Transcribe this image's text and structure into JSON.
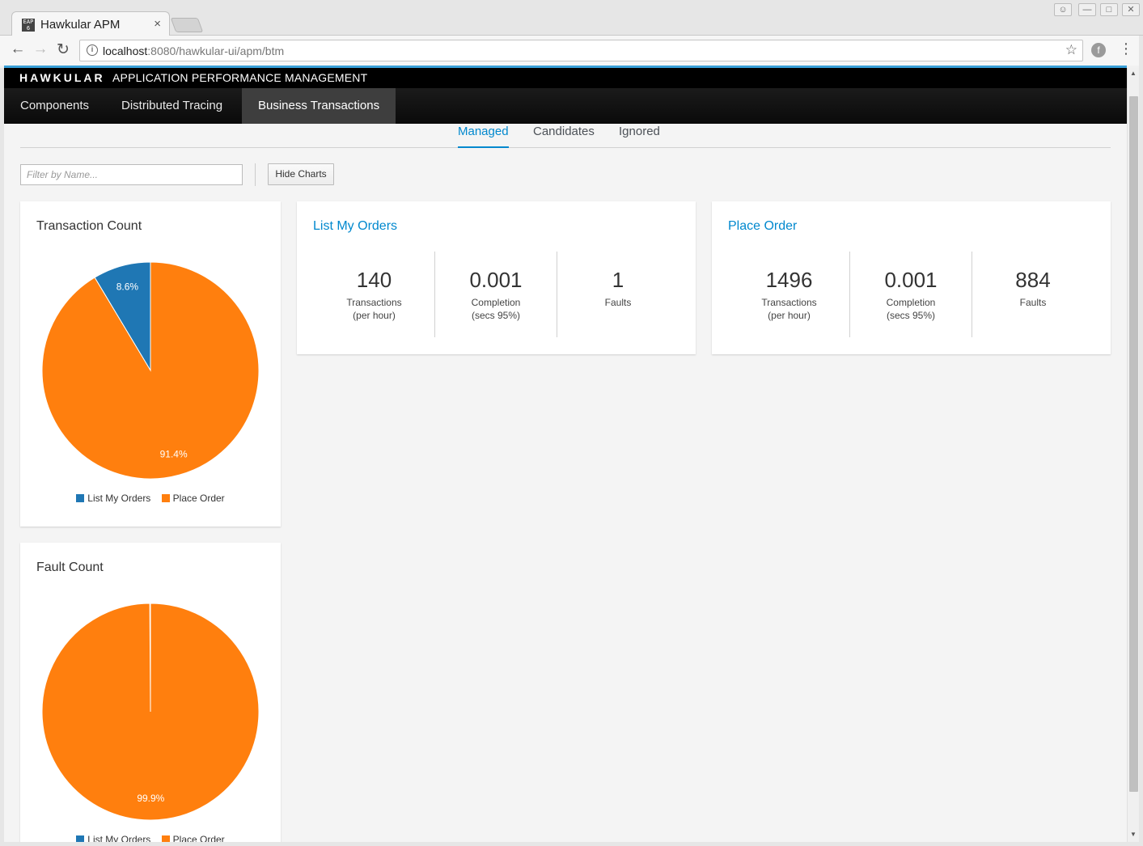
{
  "browser": {
    "tab_title": "Hawkular APM",
    "tab_favicon": "EAP 6",
    "tab_close": "×",
    "url_host": "localhost",
    "url_rest": ":8080/hawkular-ui/apm/btm",
    "icons": [
      "back-icon",
      "forward-icon",
      "reload-icon",
      "info-icon",
      "star-icon",
      "extension-icon",
      "menu-icon"
    ]
  },
  "header": {
    "brand": "HAWKULAR",
    "subtitle": "APPLICATION PERFORMANCE MANAGEMENT"
  },
  "nav": {
    "items": [
      {
        "label": "Components"
      },
      {
        "label": "Distributed Tracing"
      },
      {
        "label": "Business Transactions"
      }
    ],
    "active": "Business Transactions"
  },
  "subtabs": {
    "items": [
      {
        "label": "Managed"
      },
      {
        "label": "Candidates"
      },
      {
        "label": "Ignored"
      }
    ],
    "active": "Managed"
  },
  "filter": {
    "placeholder": "Filter by Name..."
  },
  "hide_charts_label": "Hide Charts",
  "colors": {
    "series_a": "#1f77b4",
    "series_b": "#ff7f0e",
    "link": "#0088ce"
  },
  "chart_data": [
    {
      "type": "pie",
      "title": "Transaction Count",
      "categories": [
        "List My Orders",
        "Place Order"
      ],
      "values": [
        8.6,
        91.4
      ],
      "labels": [
        "8.6%",
        "91.4%"
      ],
      "legend": "bottom"
    },
    {
      "type": "pie",
      "title": "Fault Count",
      "categories": [
        "List My Orders",
        "Place Order"
      ],
      "values": [
        0.1,
        99.9
      ],
      "labels": [
        "",
        "99.9%"
      ],
      "legend": "bottom"
    }
  ],
  "transactions": [
    {
      "name": "List My Orders",
      "metrics": [
        {
          "value": "140",
          "label1": "Transactions",
          "label2": "(per hour)"
        },
        {
          "value": "0.001",
          "label1": "Completion",
          "label2": "(secs 95%)"
        },
        {
          "value": "1",
          "label1": "Faults",
          "label2": ""
        }
      ]
    },
    {
      "name": "Place Order",
      "metrics": [
        {
          "value": "1496",
          "label1": "Transactions",
          "label2": "(per hour)"
        },
        {
          "value": "0.001",
          "label1": "Completion",
          "label2": "(secs 95%)"
        },
        {
          "value": "884",
          "label1": "Faults",
          "label2": ""
        }
      ]
    }
  ]
}
